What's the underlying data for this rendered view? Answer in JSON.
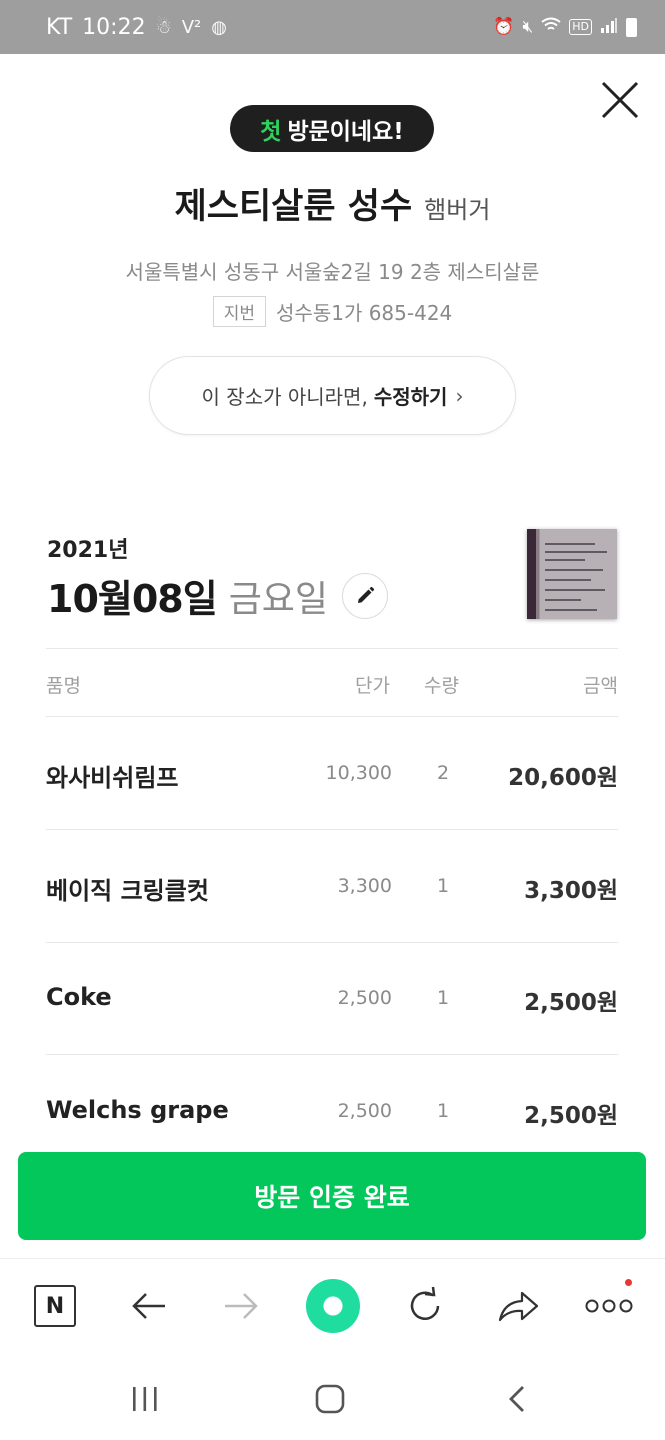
{
  "status_bar": {
    "carrier": "KT",
    "time": "10:22",
    "left_icons": [
      "notification-icon",
      "volte-icon",
      "shield-icon"
    ],
    "right_icons": [
      "alarm-icon",
      "mute-icon",
      "wifi-icon",
      "hd-icon",
      "signal-icon",
      "battery-icon"
    ],
    "hd_label": "HD"
  },
  "header": {
    "badge_highlight": "첫",
    "badge_text": "방문이네요!",
    "place_name": "제스티살룬 성수",
    "place_category": "햄버거",
    "address": "서울특별시 성동구 서울숲2길 19 2층 제스티살룬",
    "jibun_label": "지번",
    "jibun_address": "성수동1가 685-424",
    "edit_prompt": "이 장소가 아니라면,",
    "edit_action": "수정하기",
    "edit_chevron": "›"
  },
  "receipt": {
    "year": "2021년",
    "date": "10월08일",
    "weekday": "금요일",
    "columns": {
      "name": "품명",
      "unit_price": "단가",
      "quantity": "수량",
      "amount": "금액"
    },
    "items": [
      {
        "name": "와사비쉬림프",
        "unit_price": "10,300",
        "quantity": "2",
        "amount": "20,600원"
      },
      {
        "name": "베이직 크링클컷",
        "unit_price": "3,300",
        "quantity": "1",
        "amount": "3,300원"
      },
      {
        "name": "Coke",
        "unit_price": "2,500",
        "quantity": "1",
        "amount": "2,500원"
      },
      {
        "name": "Welchs grape",
        "unit_price": "2,500",
        "quantity": "1",
        "amount": "2,500원"
      }
    ]
  },
  "confirm_button": "방문 인증 완료",
  "browser_toolbar": {
    "n_label": "N",
    "items": [
      "naver-home-icon",
      "back-arrow-icon",
      "forward-arrow-icon",
      "green-dot-icon",
      "refresh-icon",
      "share-icon",
      "more-icon"
    ]
  },
  "colors": {
    "accent_green": "#03c75a",
    "badge_highlight": "#2ed35c",
    "status_bar": "#9e9e9e"
  }
}
